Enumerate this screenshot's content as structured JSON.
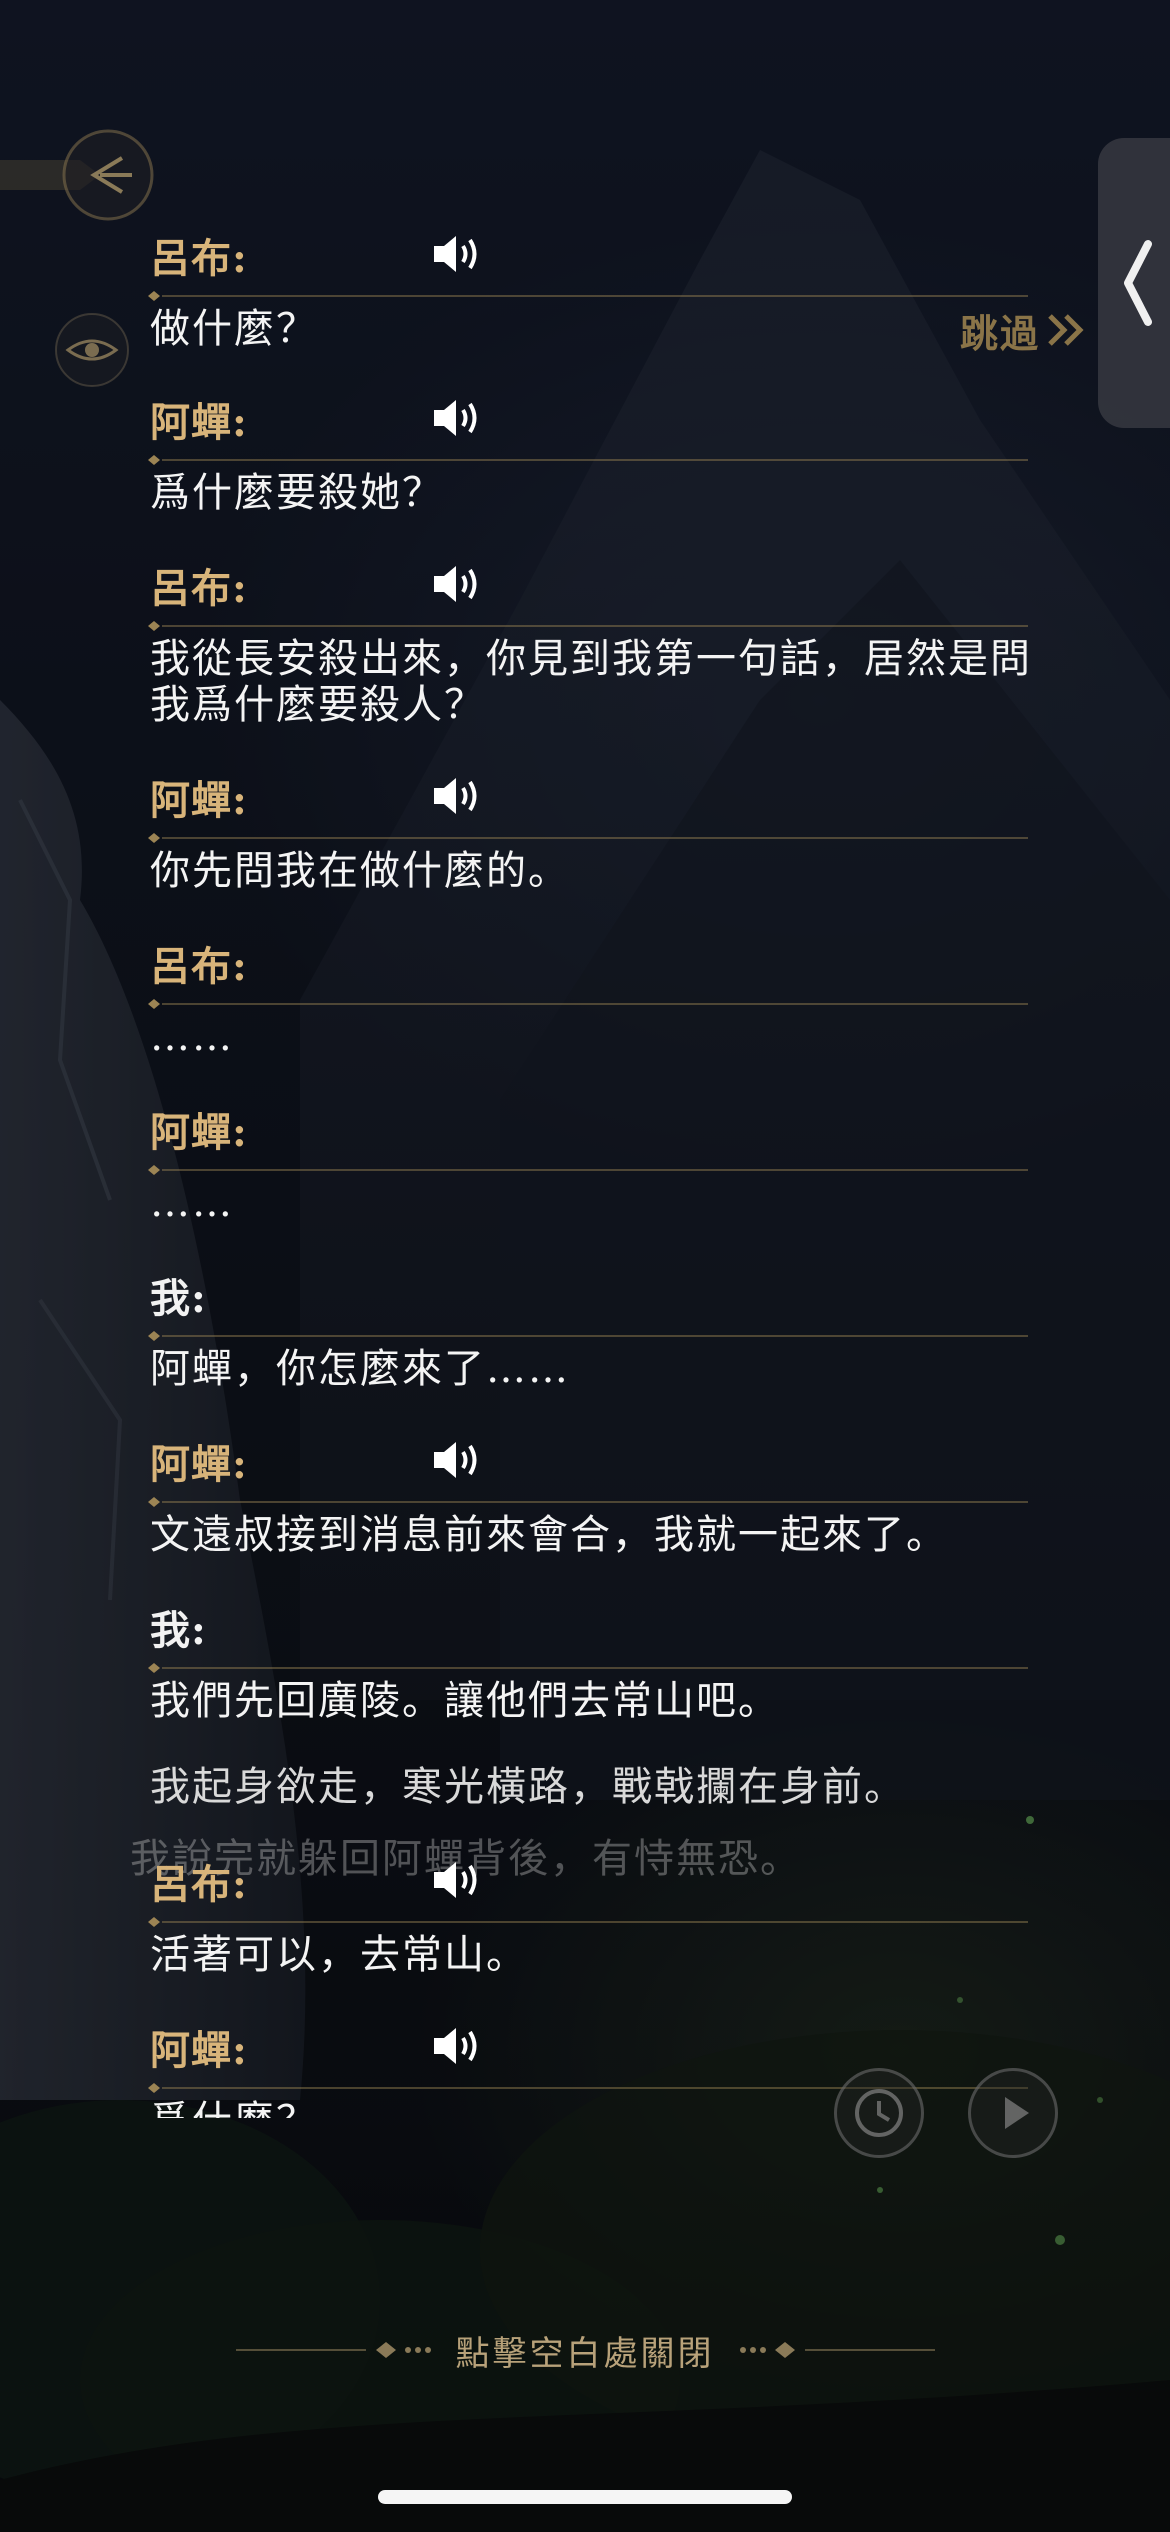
{
  "skip_label": "跳過",
  "close_hint": "點擊空白處關閉",
  "dialogue": [
    {
      "speaker": "呂布:",
      "text": "做什麼？",
      "voice": true
    },
    {
      "speaker": "阿蟬:",
      "text": "爲什麼要殺她？",
      "voice": true
    },
    {
      "speaker": "呂布:",
      "text": "我從長安殺出來，你見到我第一句話，居然是問我爲什麼要殺人？",
      "voice": true
    },
    {
      "speaker": "阿蟬:",
      "text": "你先問我在做什麼的。",
      "voice": true
    },
    {
      "speaker": "呂布:",
      "text": "……",
      "voice": false
    },
    {
      "speaker": "阿蟬:",
      "text": "……",
      "voice": false
    },
    {
      "speaker": "我:",
      "text": "阿蟬，你怎麼來了……",
      "voice": false
    },
    {
      "speaker": "阿蟬:",
      "text": "文遠叔接到消息前來會合，我就一起來了。",
      "voice": true
    },
    {
      "speaker": "我:",
      "text": "我們先回廣陵。讓他們去常山吧。",
      "voice": false
    },
    {
      "speaker": "呂布:",
      "text": "活著可以，去常山。",
      "voice": true
    },
    {
      "speaker": "阿蟬:",
      "text": "爲什麼？",
      "voice": true
    }
  ],
  "narration": "我起身欲走，寒光橫路，戰戟攔在身前。",
  "background_text": "我說完就躲回阿蟬背後，有恃無恐。",
  "colors": {
    "speaker_gold": "#d8b47a",
    "text_white": "#f4f4f4",
    "hint_gold": "#b8a27a"
  },
  "icons": {
    "back": "back-emblem-icon",
    "eye": "eye-icon",
    "panel": "chevron-left-icon",
    "voice": "speaker-volume-icon",
    "history": "history-icon",
    "auto": "play-icon"
  }
}
